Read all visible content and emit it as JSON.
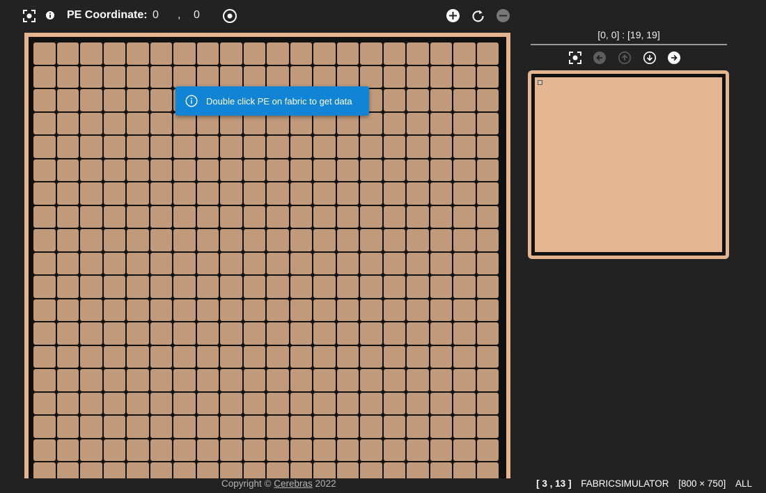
{
  "toolbar": {
    "pe_label": "PE Coordinate:",
    "pe_x": "0",
    "pe_y": "0",
    "comma": ",",
    "icons": [
      "focus-frame-icon",
      "info-icon",
      "target-icon",
      "zoom-in-icon",
      "reset-icon",
      "zoom-out-icon"
    ]
  },
  "fabric": {
    "rows": 19,
    "cols": 20,
    "pe_color": "#c09a7a",
    "border_color": "#e4b58e"
  },
  "toast": {
    "message": "Double click PE on fabric to get data",
    "color": "#1184d6"
  },
  "minimap": {
    "range_label": "[0, 0] : [19, 19]",
    "nav_icons": [
      "focus-frame-icon",
      "arrow-left-icon",
      "arrow-up-icon",
      "arrow-down-icon",
      "arrow-right-icon"
    ],
    "fill_color": "#e4b691"
  },
  "footer": {
    "copyright_prefix": "Copyright ©",
    "company": "Cerebras",
    "year": "2022"
  },
  "status": {
    "coord": "[ 3 , 13 ]",
    "app": "FABRICSIMULATOR",
    "size": "[800 × 750]",
    "mode": "ALL"
  }
}
